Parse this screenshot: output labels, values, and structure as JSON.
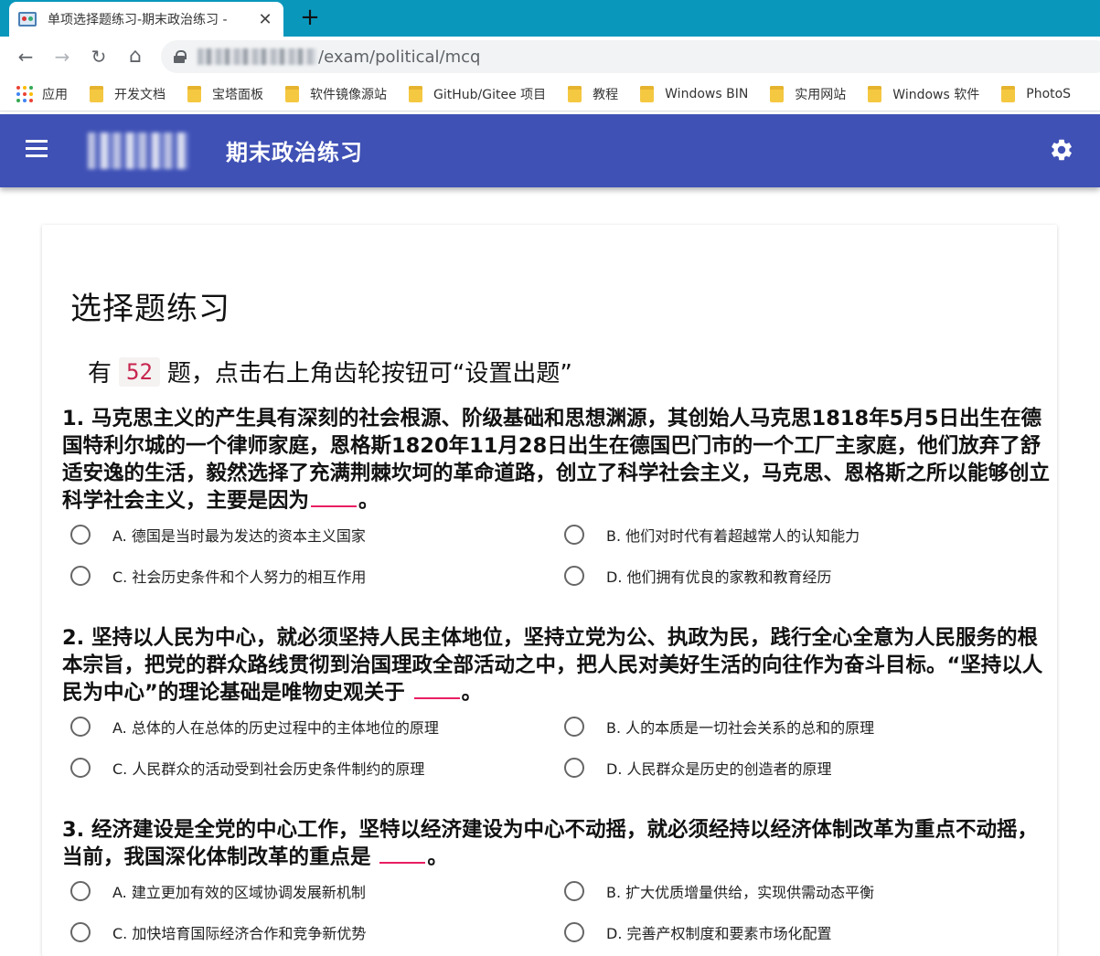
{
  "browser": {
    "tab_title": "单项选择题练习-期末政治练习 - ",
    "close_glyph": "✕",
    "newtab_glyph": "+",
    "url": "/exam/political/mcq",
    "nav": {
      "back": "←",
      "forward": "→",
      "reload": "↻",
      "home": "⌂"
    },
    "bookmarks": [
      "应用",
      "开发文档",
      "宝塔面板",
      "软件镜像源站",
      "GitHub/Gitee 项目",
      "教程",
      "Windows BIN",
      "实用网站",
      "Windows 软件",
      "PhotoS"
    ]
  },
  "appbar": {
    "title": "期末政治练习"
  },
  "colors": {
    "appbar": "#3f51b5",
    "tabstrip": "#0a97bc",
    "blank_underline": "#e91e63",
    "count_text": "#c7254e"
  },
  "page": {
    "title": "选择题练习",
    "count_prefix": "有",
    "count": "52",
    "count_suffix": "题，点击右上角齿轮按钮可“设置出题”"
  },
  "questions": [
    {
      "text": "1. 马克思主义的产生具有深刻的社会根源、阶级基础和思想渊源，其创始人马克思1818年5月5日出生在德国特利尔城的一个律师家庭，恩格斯1820年11月28日出生在德国巴门市的一个工厂主家庭，他们放弃了舒适安逸的生活，毅然选择了充满荆棘坎坷的革命道路，创立了科学社会主义，马克思、恩格斯之所以能够创立科学社会主义，主要是因为",
      "end": "。",
      "options": [
        "A. 德国是当时最为发达的资本主义国家",
        "B. 他们对时代有着超越常人的认知能力",
        "C. 社会历史条件和个人努力的相互作用",
        "D. 他们拥有优良的家教和教育经历"
      ]
    },
    {
      "text": "2. 坚持以人民为中心，就必须坚持人民主体地位，坚持立党为公、执政为民，践行全心全意为人民服务的根本宗旨，把党的群众路线贯彻到治国理政全部活动之中，把人民对美好生活的向往作为奋斗目标。“坚持以人民为中心”的理论基础是唯物史观关于 ",
      "end": "。",
      "options": [
        "A. 总体的人在总体的历史过程中的主体地位的原理",
        "B. 人的本质是一切社会关系的总和的原理",
        "C. 人民群众的活动受到社会历史条件制约的原理",
        "D. 人民群众是历史的创造者的原理"
      ]
    },
    {
      "text": "3. 经济建设是全党的中心工作，坚特以经济建设为中心不动摇，就必须经持以经济体制改革为重点不动摇，当前，我国深化体制改革的重点是 ",
      "end": "。",
      "options": [
        "A. 建立更加有效的区域协调发展新机制",
        "B. 扩大优质增量供给，实现供需动态平衡",
        "C. 加快培育国际经济合作和竞争新优势",
        "D. 完善产权制度和要素市场化配置"
      ]
    }
  ]
}
